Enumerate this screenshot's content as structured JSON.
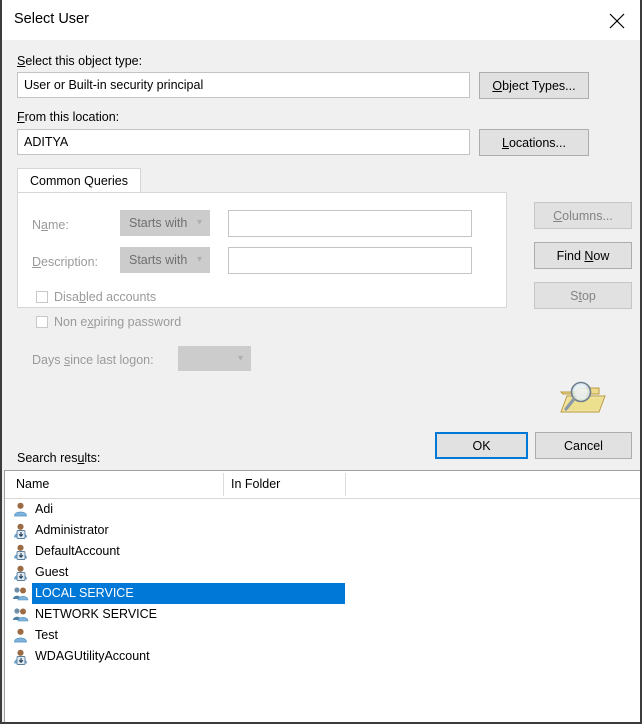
{
  "window": {
    "title": "Select User",
    "close_icon": "close-icon"
  },
  "form": {
    "object_type_label": "Select this object type:",
    "object_type_label_acc": "S",
    "object_type_value": "User or Built-in security principal",
    "object_types_button": "Object Types...",
    "object_types_button_acc": "O",
    "location_label": "From this location:",
    "location_label_acc": "F",
    "location_value": "ADITYA",
    "locations_button": "Locations...",
    "locations_button_acc": "L"
  },
  "tabs": {
    "items": [
      {
        "label": "Common Queries",
        "selected": true
      }
    ]
  },
  "query": {
    "name_label": "Name:",
    "name_label_acc": "a",
    "name_operator": "Starts with",
    "name_value": "",
    "name_placeholder": "",
    "description_label": "Description:",
    "description_label_acc": "D",
    "description_operator": "Starts with",
    "description_value": "",
    "description_placeholder": "",
    "disabled_accounts_label": "Disabled accounts",
    "disabled_accounts_acc": "b",
    "disabled_accounts_checked": false,
    "non_expiring_label": "Non expiring password",
    "non_expiring_acc": "x",
    "non_expiring_checked": false,
    "days_since_logon_label": "Days since last logon:",
    "days_since_logon_acc": "s",
    "days_since_logon_value": ""
  },
  "side_buttons": {
    "columns": "Columns...",
    "columns_acc": "C",
    "columns_enabled": false,
    "find_now": "Find Now",
    "find_now_acc": "N",
    "find_now_enabled": true,
    "stop": "Stop",
    "stop_acc": "t",
    "stop_enabled": false,
    "search_icon": "magnifier-folder-icon"
  },
  "actions": {
    "ok": "OK",
    "cancel": "Cancel"
  },
  "results": {
    "label": "Search results:",
    "label_acc": "u",
    "columns": [
      "Name",
      "In Folder"
    ],
    "rows": [
      {
        "name": "Adi",
        "in_folder": "",
        "icon": "user-icon",
        "selected": false
      },
      {
        "name": "Administrator",
        "in_folder": "",
        "icon": "user-disabled-icon",
        "selected": false
      },
      {
        "name": "DefaultAccount",
        "in_folder": "",
        "icon": "user-disabled-icon",
        "selected": false
      },
      {
        "name": "Guest",
        "in_folder": "",
        "icon": "user-disabled-icon",
        "selected": false
      },
      {
        "name": "LOCAL SERVICE",
        "in_folder": "",
        "icon": "group-icon",
        "selected": true
      },
      {
        "name": "NETWORK SERVICE",
        "in_folder": "",
        "icon": "group-icon",
        "selected": false
      },
      {
        "name": "Test",
        "in_folder": "",
        "icon": "user-icon",
        "selected": false
      },
      {
        "name": "WDAGUtilityAccount",
        "in_folder": "",
        "icon": "user-disabled-icon",
        "selected": false
      }
    ]
  },
  "colors": {
    "selection": "#0078d7",
    "dialog_bg": "#f0f0f0",
    "disabled_text": "#9a9a9a"
  }
}
